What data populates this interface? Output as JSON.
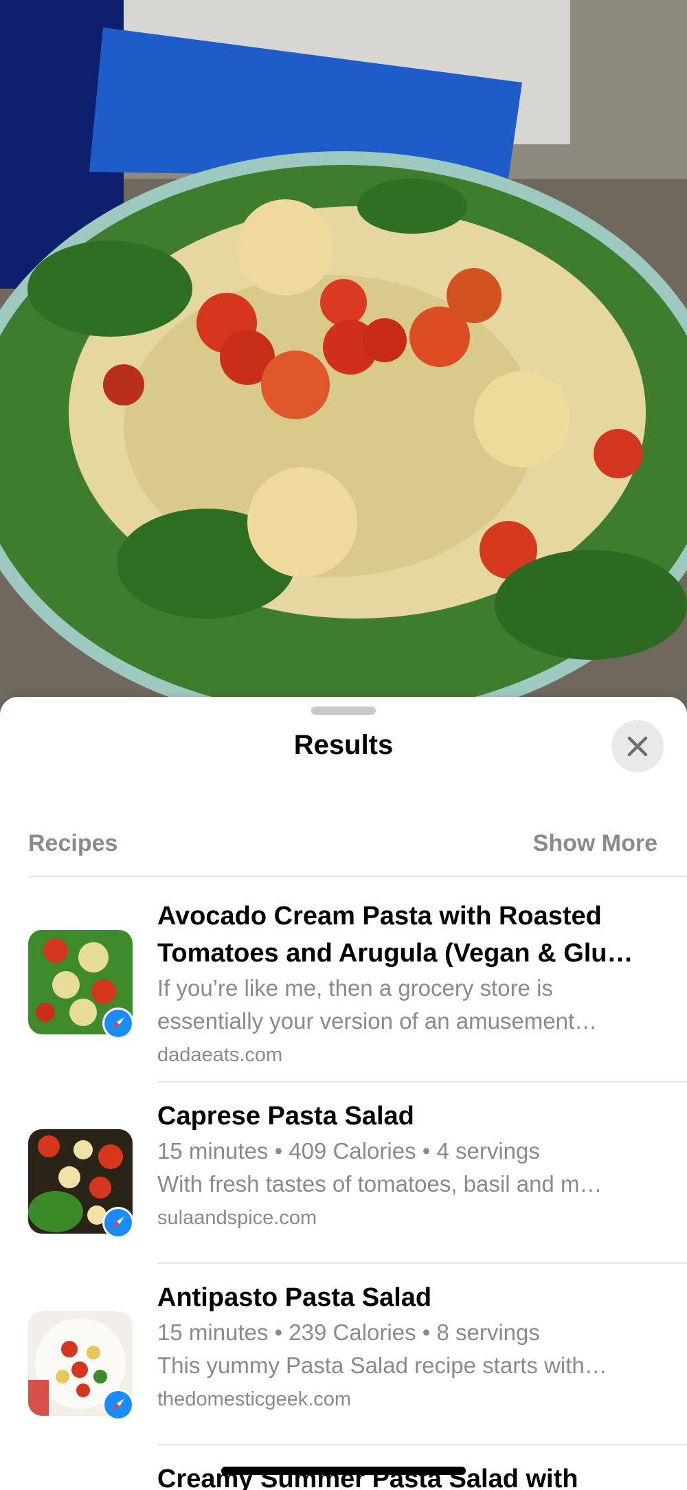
{
  "sheet": {
    "title": "Results",
    "close_icon": "xmark-icon"
  },
  "section": {
    "label": "Recipes",
    "show_more": "Show More"
  },
  "results": [
    {
      "title_line1": "Avocado Cream Pasta with Roasted",
      "title_line2": "Tomatoes and Arugula (Vegan & Glu…",
      "line1": "If you’re like me, then a grocery store is",
      "line2": "essentially your version of an amusement…",
      "source": "dadaeats.com",
      "badge_icon": "safari-icon"
    },
    {
      "title_line1": "Caprese Pasta Salad",
      "line1": "15 minutes • 409 Calories • 4 servings",
      "line2": "With fresh tastes of tomatoes, basil and m…",
      "source": "sulaandspice.com",
      "badge_icon": "safari-icon"
    },
    {
      "title_line1": "Antipasto Pasta Salad",
      "line1": "15 minutes • 239 Calories • 8 servings",
      "line2": "This yummy Pasta Salad recipe starts with…",
      "source": "thedomesticgeek.com",
      "badge_icon": "safari-icon"
    },
    {
      "title_line1": "Creamy Summer Pasta Salad with"
    }
  ],
  "colors": {
    "secondary_text": "#8a8a8e",
    "divider": "#e5e5ea",
    "safari_blue": "#1a8cff"
  }
}
